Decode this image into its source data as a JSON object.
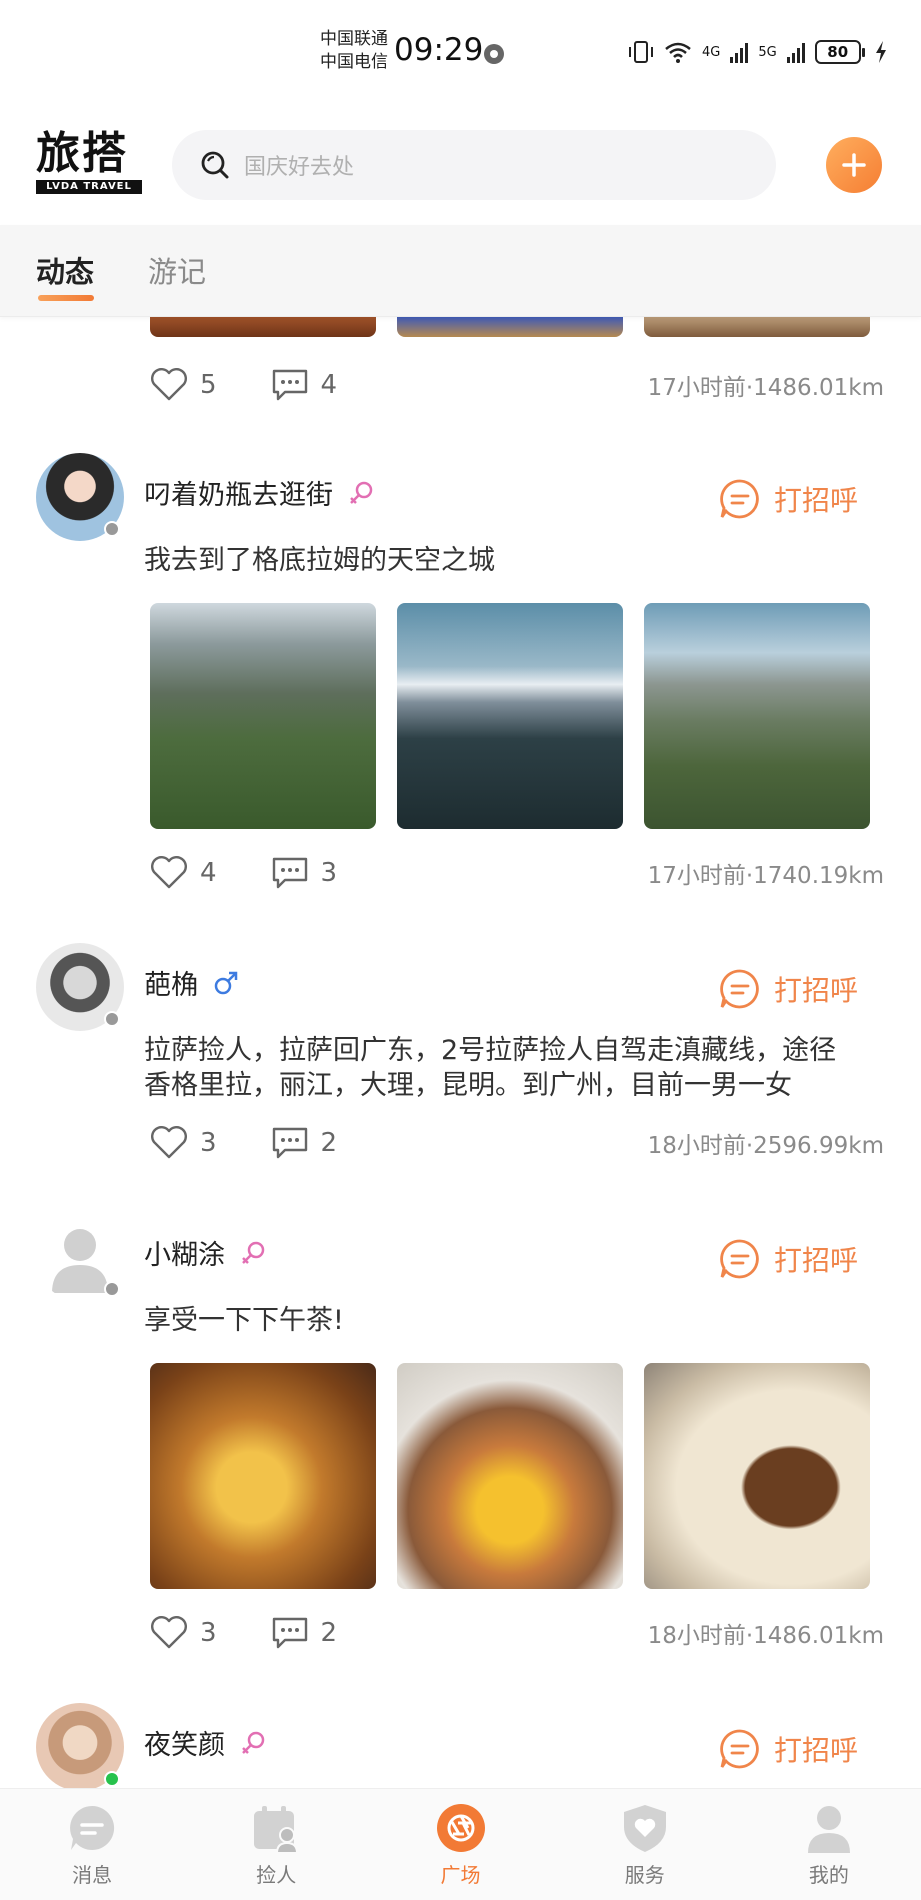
{
  "status_bar": {
    "carrier_1": "中国联通",
    "carrier_2": "中国电信",
    "time": "09:29",
    "net_1": "4G",
    "net_2": "5G",
    "battery": "80"
  },
  "header": {
    "logo_main": "旅搭",
    "logo_sub": "LVDA TRAVEL",
    "search_placeholder": "国庆好去处",
    "add_icon": "plus-icon"
  },
  "tabs": [
    {
      "label": "动态",
      "active": true
    },
    {
      "label": "游记",
      "active": false
    }
  ],
  "feed": {
    "partial_post": {
      "likes": "5",
      "comments": "4",
      "meta": "17小时前·1486.01km"
    },
    "posts": [
      {
        "username": "叼着奶瓶去逛街",
        "gender": "female",
        "greet": "打招呼",
        "content": "我去到了格底拉姆的天空之城",
        "images": [
          "mountain-meadow-photo",
          "snow-peaks-photo",
          "valley-photo"
        ],
        "likes": "4",
        "comments": "3",
        "meta": "17小时前·1740.19km",
        "online": false
      },
      {
        "username": "葩桷",
        "gender": "male",
        "greet": "打招呼",
        "content_line1": "拉萨捡人，拉萨回广东，2号拉萨捡人自驾走滇藏线，途径",
        "content_line2": "香格里拉，丽江，大理，昆明。到广州，目前一男一女",
        "images": [],
        "likes": "3",
        "comments": "2",
        "meta": "18小时前·2596.99km",
        "online": false
      },
      {
        "username": "小糊涂",
        "gender": "female",
        "greet": "打招呼",
        "content": "享受一下下午茶!",
        "images": [
          "cheese-toast-photo",
          "fries-platter-photo",
          "cake-photo"
        ],
        "likes": "3",
        "comments": "2",
        "meta": "18小时前·1486.01km",
        "online": false
      },
      {
        "username": "夜笑颜",
        "gender": "female",
        "greet": "打招呼",
        "online": true
      }
    ]
  },
  "bottom_nav": [
    {
      "label": "消息",
      "icon": "message-icon",
      "active": false
    },
    {
      "label": "捡人",
      "icon": "pickup-icon",
      "active": false
    },
    {
      "label": "广场",
      "icon": "plaza-icon",
      "active": true
    },
    {
      "label": "服务",
      "icon": "service-icon",
      "active": false
    },
    {
      "label": "我的",
      "icon": "profile-icon",
      "active": false
    }
  ],
  "colors": {
    "accent": "#f27a35",
    "female": "#e26fb3",
    "male": "#3d7be0"
  }
}
